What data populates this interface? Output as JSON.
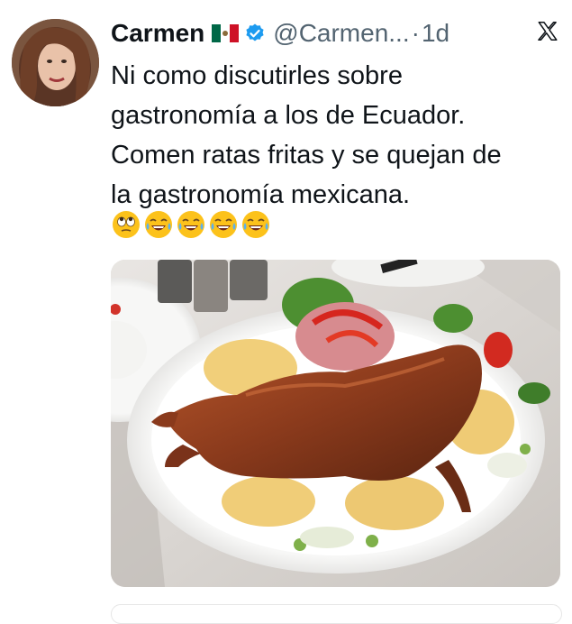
{
  "author": {
    "name": "Carmen",
    "handle": "@Carmen...",
    "separator": "·",
    "time": "1d",
    "flag_icon": "mexico-flag-icon",
    "verified_icon": "verified-badge-icon"
  },
  "tweet": {
    "lines": [
      "Ni como discutirles sobre",
      "gastronomía a los de Ecuador.",
      "Comen ratas fritas y se quejan de",
      "la gastronomía mexicana."
    ],
    "emojis": [
      "eye-roll-emoji",
      "tears-of-joy-emoji",
      "tears-of-joy-emoji",
      "tears-of-joy-emoji",
      "tears-of-joy-emoji"
    ]
  },
  "media": {
    "icon": "photo-roasted-guinea-pig-plate"
  },
  "colors": {
    "verified": "#1d9bf0",
    "secondary_text": "#536471",
    "primary_text": "#0f1419"
  }
}
